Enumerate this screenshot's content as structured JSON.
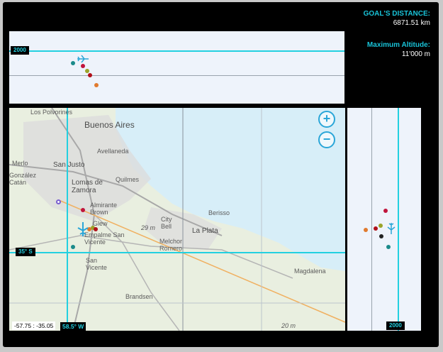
{
  "stats": {
    "goal_label": "GOAL'S DISTANCE:",
    "goal_value": "6871.51 km",
    "alt_label": "Maximum Altitude:",
    "alt_value": "11'000 m"
  },
  "top_profile": {
    "altitude_tag": "2000"
  },
  "side_profile": {
    "altitude_tag": "2000"
  },
  "map": {
    "latitude_tag": "35° S",
    "longitude_tag": "58.5° W",
    "coord_readout": "-57.75 : -35.05",
    "zoom_in": "+",
    "zoom_out": "−",
    "depth_label_1": "29 m",
    "depth_label_2": "20 m",
    "places": [
      {
        "name": "Los Polvorines",
        "cls": ""
      },
      {
        "name": "Buenos Aires",
        "cls": "big"
      },
      {
        "name": "Avellaneda",
        "cls": ""
      },
      {
        "name": "San Justo",
        "cls": "med"
      },
      {
        "name": "Merlo",
        "cls": ""
      },
      {
        "name": "González Catán",
        "cls": ""
      },
      {
        "name": "Lomas de Zamora",
        "cls": "med"
      },
      {
        "name": "Quilmes",
        "cls": ""
      },
      {
        "name": "Almirante Brown",
        "cls": ""
      },
      {
        "name": "Glew",
        "cls": ""
      },
      {
        "name": "Empalme San Vicente",
        "cls": ""
      },
      {
        "name": "City Bell",
        "cls": ""
      },
      {
        "name": "Berisso",
        "cls": ""
      },
      {
        "name": "La Plata",
        "cls": "med"
      },
      {
        "name": "Melchor Romero",
        "cls": ""
      },
      {
        "name": "San Vicente",
        "cls": ""
      },
      {
        "name": "Magdalena",
        "cls": ""
      },
      {
        "name": "Brandsen",
        "cls": ""
      }
    ]
  },
  "colors": {
    "accent": "#23d0e0",
    "label": "#19c3d8",
    "dot_teal": "#1a8a8a",
    "dot_red": "#c0143c",
    "dot_orange": "#e07a2e",
    "dot_olive": "#9aa42a",
    "dot_darkred": "#b0101a",
    "dot_purple": "#7a5fd0"
  },
  "icons": {
    "plane": "plane-icon"
  }
}
